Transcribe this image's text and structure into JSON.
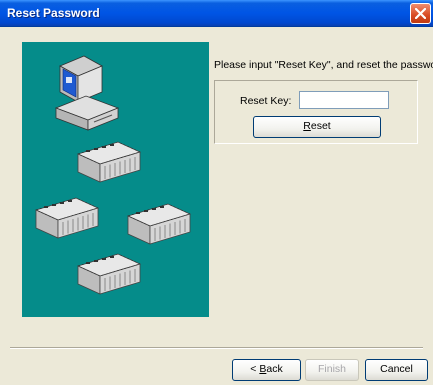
{
  "window": {
    "title": "Reset Password",
    "close_icon": "close-icon"
  },
  "graphic": {
    "background_color": "#058c8a",
    "icons": [
      "computer-icon",
      "plc-device-icon",
      "plc-device-icon",
      "plc-device-icon",
      "plc-device-icon"
    ]
  },
  "form": {
    "instruction": "Please input \"Reset Key\", and reset the password.",
    "reset_key_label": "Reset Key:",
    "reset_key_value": "",
    "reset_button_prefix": "",
    "reset_button_mnemonic": "R",
    "reset_button_rest": "eset"
  },
  "footer": {
    "back_prefix": "< ",
    "back_mnemonic": "B",
    "back_rest": "ack",
    "finish_label": "Finish",
    "cancel_label": "Cancel"
  },
  "colors": {
    "titlebar": "#0055e5",
    "dialog_background": "#ece9d8",
    "close_button": "#d84a22"
  }
}
